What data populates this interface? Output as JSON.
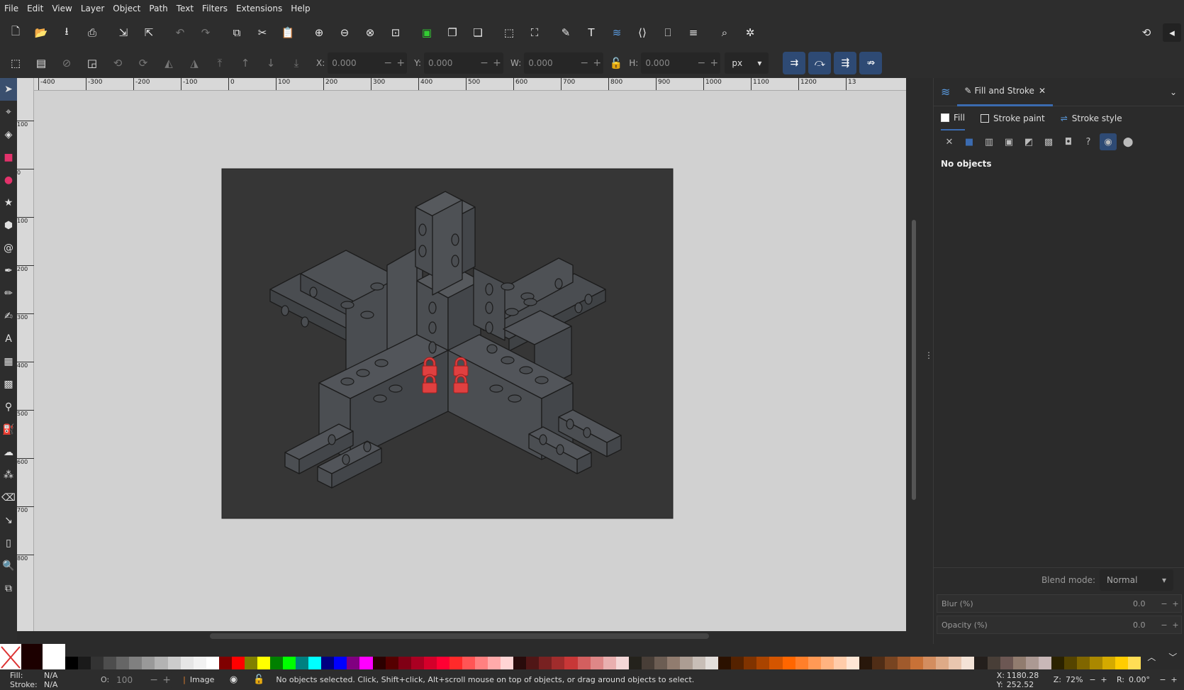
{
  "menu": [
    "File",
    "Edit",
    "View",
    "Layer",
    "Object",
    "Path",
    "Text",
    "Filters",
    "Extensions",
    "Help"
  ],
  "controls": {
    "x_label": "X:",
    "x_value": "0.000",
    "y_label": "Y:",
    "y_value": "0.000",
    "w_label": "W:",
    "w_value": "0.000",
    "h_label": "H:",
    "h_value": "0.000",
    "unit": "px"
  },
  "ruler": {
    "h_ticks": [
      "-400",
      "-300",
      "-200",
      "-100",
      "0",
      "100",
      "200",
      "300",
      "400",
      "500",
      "600",
      "700",
      "800",
      "900",
      "1000",
      "1100",
      "1200",
      "13"
    ],
    "v_ticks": [
      "100",
      "0",
      "100",
      "200",
      "300",
      "400",
      "500",
      "600",
      "700",
      "800"
    ]
  },
  "panel": {
    "tab_label": "Fill and Stroke",
    "fill_tab": "Fill",
    "stroke_paint_tab": "Stroke paint",
    "stroke_style_tab": "Stroke style",
    "no_objects": "No objects",
    "blend_label": "Blend mode:",
    "blend_value": "Normal",
    "blur_label": "Blur (%)",
    "blur_value": "0.0",
    "opacity_label": "Opacity (%)",
    "opacity_value": "0.0"
  },
  "status": {
    "fill_label": "Fill:",
    "fill_value": "N/A",
    "stroke_label": "Stroke:",
    "stroke_value": "N/A",
    "opacity_label": "O:",
    "opacity_value": "100",
    "layer": "Image",
    "message": "No objects selected. Click, Shift+click, Alt+scroll mouse on top of objects, or drag around objects to select.",
    "x_label": "X:",
    "x_value": "1180.28",
    "y_label": "Y:",
    "y_value": "252.52",
    "zoom_label": "Z:",
    "zoom_value": "72%",
    "rotation_label": "R:",
    "rotation_value": "0.00°"
  },
  "palette_colors": [
    "#000000",
    "#1a1a1a",
    "#333333",
    "#4d4d4d",
    "#666666",
    "#808080",
    "#999999",
    "#b3b3b3",
    "#cccccc",
    "#e6e6e6",
    "#f2f2f2",
    "#ffffff",
    "#800000",
    "#ff0000",
    "#808000",
    "#ffff00",
    "#008000",
    "#00ff00",
    "#008080",
    "#00ffff",
    "#000080",
    "#0000ff",
    "#800080",
    "#ff00ff",
    "#2b0000",
    "#550000",
    "#800015",
    "#aa0022",
    "#d4002a",
    "#ff0033",
    "#ff2a2a",
    "#ff5555",
    "#ff8080",
    "#ffaaaa",
    "#ffd5d5",
    "#280b0b",
    "#501616",
    "#782121",
    "#a02c2c",
    "#c83737",
    "#d35f5f",
    "#de8787",
    "#e9afaf",
    "#f4d7d7",
    "#24221c",
    "#483e37",
    "#6c5d53",
    "#917c6f",
    "#ac9d93",
    "#c8beb7",
    "#e3dedb",
    "#2b1100",
    "#552200",
    "#803300",
    "#aa4400",
    "#d45500",
    "#ff6600",
    "#ff7f2a",
    "#ff9955",
    "#ffb380",
    "#ffccaa",
    "#ffe6d5",
    "#28170b",
    "#502d16",
    "#784421",
    "#a05a2c",
    "#c87137",
    "#d38d5f",
    "#deaa87",
    "#e9c6af",
    "#f4e3d7",
    "#241f1c",
    "#483e37",
    "#6c5753",
    "#917c6f",
    "#ac9993",
    "#c8b7b7",
    "#2b2200",
    "#554400",
    "#806600",
    "#aa8800",
    "#d4aa00",
    "#ffcc00",
    "#ffdd55"
  ]
}
